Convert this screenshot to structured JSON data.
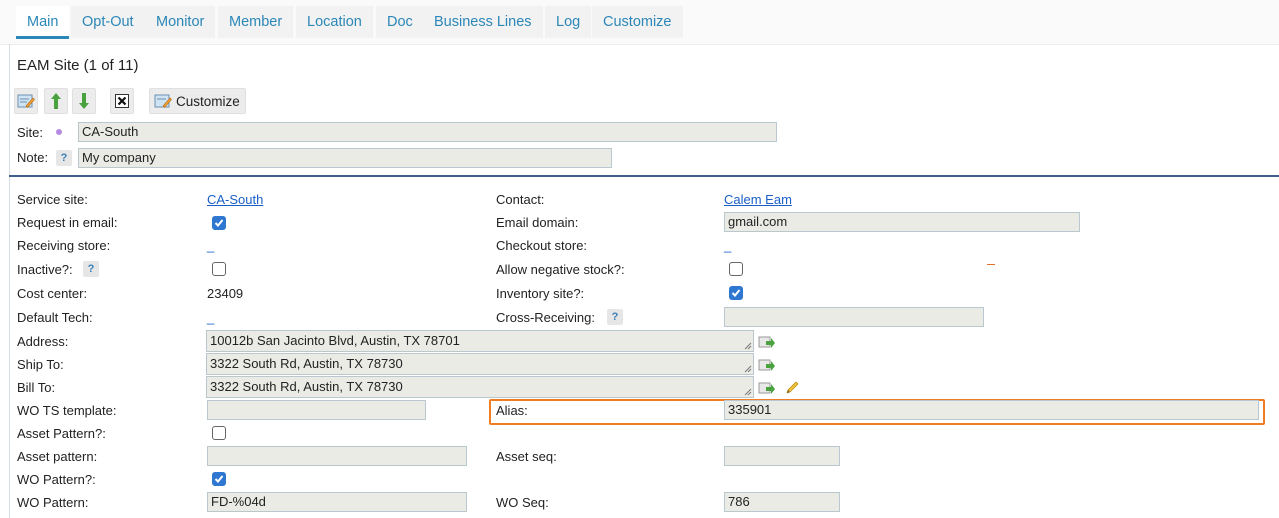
{
  "tabs": [
    {
      "label": "Main"
    },
    {
      "label": "Opt-Out"
    },
    {
      "label": "Monitor"
    },
    {
      "label": "Member"
    },
    {
      "label": "Location"
    },
    {
      "label": "Doc"
    },
    {
      "label": "Business Lines"
    },
    {
      "label": "Log"
    },
    {
      "label": "Customize"
    }
  ],
  "title": "EAM Site (1 of 11)",
  "toolbar": {
    "customize_label": "Customize",
    "icons": [
      "edit-icon",
      "move-up-icon",
      "move-down-icon",
      "close-icon",
      "customize-icon"
    ]
  },
  "header": {
    "site_label": "Site:",
    "site_value": "CA-South",
    "note_label": "Note:",
    "note_help": "?",
    "note_value": "My company"
  },
  "form": {
    "service_site": {
      "label": "Service site:",
      "value": "CA-South"
    },
    "request_in_email": {
      "label": "Request in email:",
      "checked": true
    },
    "receiving_store": {
      "label": "Receiving store:",
      "value": "_"
    },
    "inactive": {
      "label": "Inactive?:",
      "help": "?",
      "checked": false
    },
    "cost_center": {
      "label": "Cost center:",
      "value": "23409"
    },
    "default_tech": {
      "label": "Default Tech:",
      "value": "_"
    },
    "address": {
      "label": "Address:",
      "value": "10012b San Jacinto Blvd, Austin, TX 78701"
    },
    "ship_to": {
      "label": "Ship To:",
      "value": "3322 South Rd, Austin, TX 78730"
    },
    "bill_to": {
      "label": "Bill To:",
      "value": "3322 South Rd, Austin, TX 78730"
    },
    "wo_ts_template": {
      "label": "WO TS template:",
      "value": ""
    },
    "asset_pattern_flag": {
      "label": "Asset Pattern?:",
      "checked": false
    },
    "asset_pattern": {
      "label": "Asset pattern:",
      "value": ""
    },
    "wo_pattern_flag": {
      "label": "WO Pattern?:",
      "checked": true
    },
    "wo_pattern": {
      "label": "WO Pattern:",
      "value": "FD-%04d"
    },
    "contact": {
      "label": "Contact:",
      "value": "Calem Eam"
    },
    "email_domain": {
      "label": "Email domain:",
      "value": "gmail.com"
    },
    "checkout_store": {
      "label": "Checkout store:",
      "value": "_"
    },
    "allow_negative_stock": {
      "label": "Allow negative stock?:",
      "checked": false
    },
    "inventory_site": {
      "label": "Inventory site?:",
      "checked": true
    },
    "cross_receiving": {
      "label": "Cross-Receiving:",
      "help": "?",
      "value": ""
    },
    "alias": {
      "label": "Alias:",
      "value": "335901"
    },
    "asset_seq": {
      "label": "Asset seq:",
      "value": ""
    },
    "wo_seq": {
      "label": "WO Seq:",
      "value": "786"
    }
  },
  "colors": {
    "tab_text": "#2b87b8",
    "link": "#1a5fc7",
    "checkbox_on": "#2f77d1",
    "highlight": "#f07c23",
    "separator": "#3d5f89"
  }
}
